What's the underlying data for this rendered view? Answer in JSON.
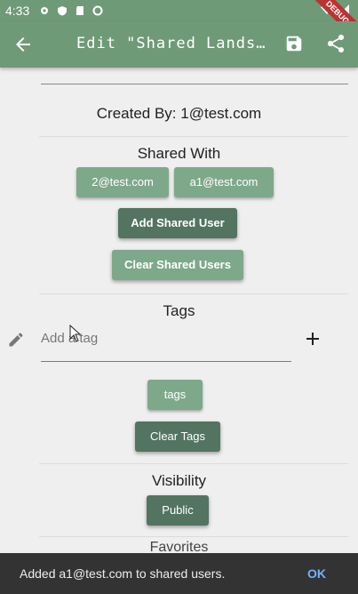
{
  "status_bar": {
    "time": "4:33"
  },
  "debug_ribbon": "DEBUG",
  "app_bar": {
    "title": "Edit \"Shared Landscape ...",
    "back_icon": "arrow-back-icon",
    "save_icon": "save-icon",
    "share_icon": "share-icon"
  },
  "created_by": "Created By: 1@test.com",
  "shared_with": {
    "heading": "Shared With",
    "users": [
      "2@test.com",
      "a1@test.com"
    ],
    "add_button": "Add Shared User",
    "clear_button": "Clear Shared Users"
  },
  "tags": {
    "heading": "Tags",
    "input_placeholder": "Add a tag",
    "chips": [
      "tags"
    ],
    "clear_button": "Clear Tags"
  },
  "visibility": {
    "heading": "Visibility",
    "value": "Public"
  },
  "next_section_peek": "Favorites",
  "snackbar": {
    "message": "Added a1@test.com to shared users.",
    "action": "OK"
  },
  "colors": {
    "primary": "#6f9a78",
    "chip": "#7ea88a",
    "button_dark": "#527460",
    "snackbar_bg": "#333333",
    "snackbar_action": "#6fb4ff"
  }
}
